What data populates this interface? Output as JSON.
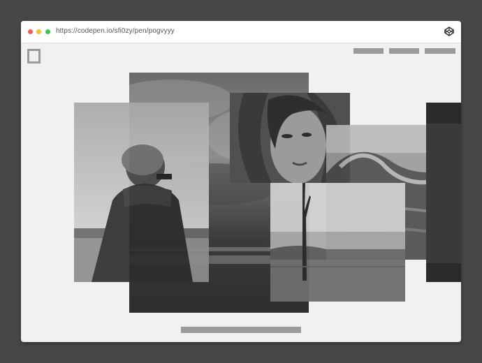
{
  "browser": {
    "url": "https://codepen.io/sfi0zy/pen/pogvyyy",
    "traffic_lights": {
      "close": "#f25f58",
      "minimize": "#f9be2f",
      "zoom": "#3ac54a"
    },
    "codepen_icon": "codepen-cube-icon"
  },
  "page": {
    "logo_icon": "square-outline-logo",
    "nav_items": 3,
    "accent_gray": "#9a9a9a",
    "background": "#f1f1f1"
  },
  "gallery": {
    "style": "grayscale",
    "photos": [
      {
        "name": "photo-stormy-sky",
        "subject": "stormy sky over sea"
      },
      {
        "name": "photo-man-on-shore",
        "subject": "man in jacket looking at sea"
      },
      {
        "name": "photo-woman-portrait",
        "subject": "woman portrait"
      },
      {
        "name": "photo-wave",
        "subject": "ocean wave"
      },
      {
        "name": "photo-dead-tree",
        "subject": "bare tree on beach"
      },
      {
        "name": "photo-dark-edge",
        "subject": "dark partial photo"
      }
    ]
  }
}
